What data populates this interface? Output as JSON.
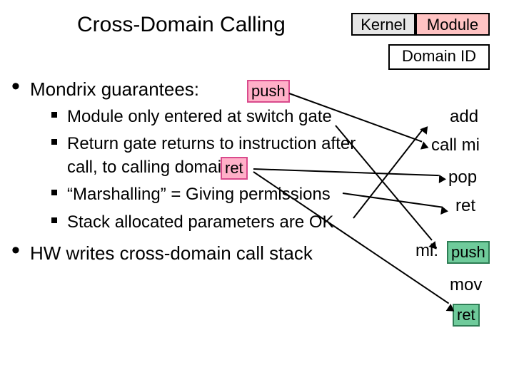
{
  "title": "Cross-Domain Calling",
  "top_boxes": {
    "kernel": "Kernel",
    "module": "Module",
    "domain_id": "Domain ID"
  },
  "bullets": {
    "main1": "Mondrix guarantees:",
    "sub1": "Module only entered at switch gate",
    "sub2a": "Return gate returns to instruction after",
    "sub2b": "call, to calling domain",
    "sub3": "“Marshalling” = Giving permissions",
    "sub4": "Stack allocated parameters are OK",
    "main2": "HW writes cross-domain call stack"
  },
  "inline_ops": {
    "push": "push",
    "ret": "ret"
  },
  "side_ops": {
    "add": "add",
    "call_mi": "call mi",
    "pop": "pop",
    "ret": "ret",
    "mi_label": "mi:",
    "push": "push",
    "mov": "mov",
    "ret2": "ret"
  }
}
